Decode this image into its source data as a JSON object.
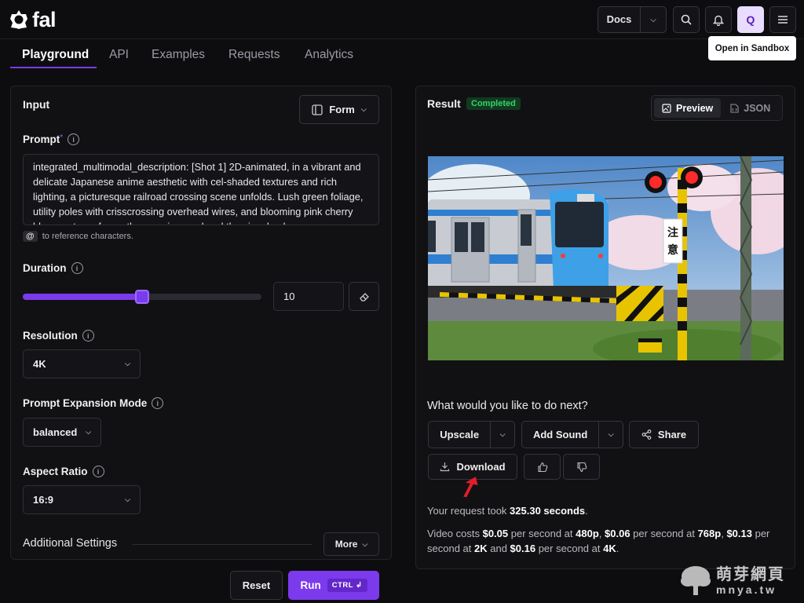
{
  "brand": {
    "name": "fal"
  },
  "header": {
    "docs_label": "Docs",
    "avatar_letter": "Q"
  },
  "nav": {
    "tabs": [
      "Playground",
      "API",
      "Examples",
      "Requests",
      "Analytics"
    ],
    "active": "Playground",
    "sandbox_label": "Open in Sandbox"
  },
  "input": {
    "title": "Input",
    "mode_label": "Form",
    "prompt_label": "Prompt",
    "prompt_required": "*",
    "prompt_value": "integrated_multimodal_description: [Shot 1] 2D-animated, in a vibrant and delicate Japanese anime aesthetic with cel-shaded textures and rich lighting, a picturesque railroad crossing scene unfolds. Lush green foliage, utility poles with crisscrossing overhead wires, and blooming pink cherry blossom trees frame the crossing road and the signal pole.",
    "reference_hint_at": "@",
    "reference_hint": "to reference characters.",
    "duration_label": "Duration",
    "duration_value": "10",
    "duration_fraction": 0.5,
    "resolution_label": "Resolution",
    "resolution_value": "4K",
    "expansion_label": "Prompt Expansion Mode",
    "expansion_value": "balanced",
    "aspect_label": "Aspect Ratio",
    "aspect_value": "16:9",
    "additional_label": "Additional Settings",
    "more_label": "More",
    "reset_label": "Reset",
    "run_label": "Run",
    "run_kbd": "CTRL ↲"
  },
  "result": {
    "title": "Result",
    "status": "Completed",
    "preview_label": "Preview",
    "json_label": "JSON",
    "next_question": "What would you like to do next?",
    "upscale_label": "Upscale",
    "add_sound_label": "Add Sound",
    "share_label": "Share",
    "download_label": "Download",
    "took_prefix": "Your request took ",
    "took_value": "325.30 seconds",
    "took_suffix": ".",
    "cost_parts": [
      "Video costs ",
      "$0.05",
      " per second at ",
      "480p",
      ", ",
      "$0.06",
      " per second at ",
      "768p",
      ", ",
      "$0.13",
      " per second at ",
      "2K",
      " and ",
      "$0.16",
      " per second at ",
      "4K",
      "."
    ],
    "image_sign_text": "注意"
  },
  "watermark": {
    "title": "萌芽網頁",
    "url": "mnya.tw"
  },
  "colors": {
    "accent": "#7c3aed",
    "success": "#34d36b",
    "arrow": "#e11d2a"
  }
}
